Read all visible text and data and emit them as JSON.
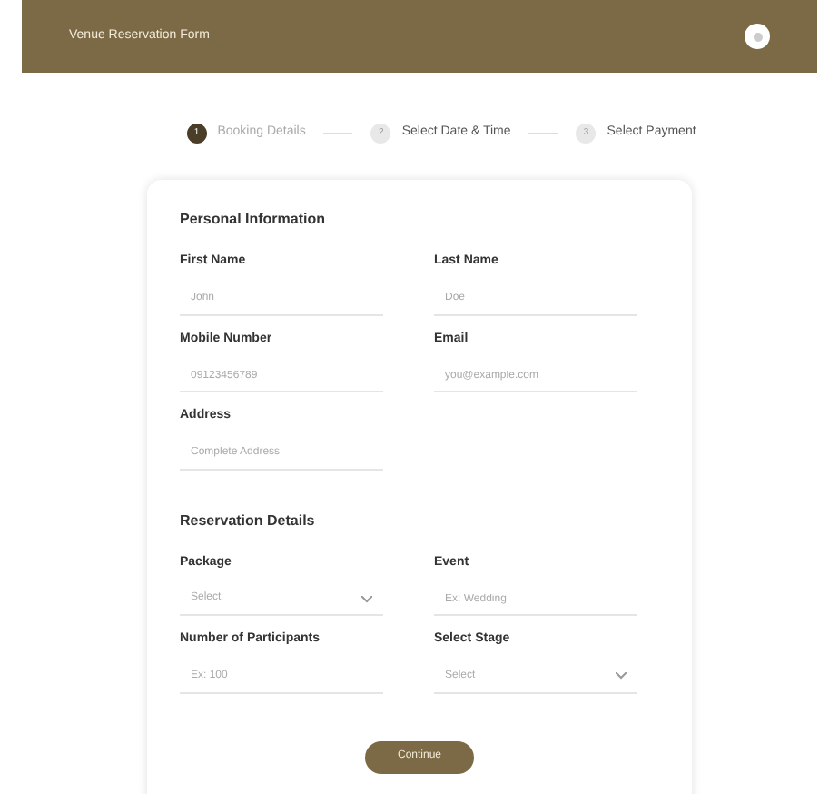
{
  "header": {
    "title": "Venue Reservation Form"
  },
  "steps": [
    {
      "number": "1",
      "label": "Booking Details",
      "selected": true
    },
    {
      "number": "2",
      "label": "Select Date & Time",
      "selected": false
    },
    {
      "number": "3",
      "label": "Select Payment",
      "selected": false
    }
  ],
  "sections": [
    {
      "title": "Personal Information",
      "fields": [
        {
          "label": "First Name",
          "placeholder": "John",
          "kind": "text"
        },
        {
          "label": "Last Name",
          "placeholder": "Doe",
          "kind": "text"
        },
        {
          "label": "Mobile Number",
          "placeholder": "09123456789",
          "kind": "text"
        },
        {
          "label": "Email",
          "placeholder": "you@example.com",
          "kind": "text"
        },
        {
          "label": "Address",
          "placeholder": "Complete Address",
          "kind": "text"
        }
      ]
    },
    {
      "title": "Reservation Details",
      "fields": [
        {
          "label": "Package",
          "placeholder": "Select",
          "kind": "select"
        },
        {
          "label": "Event",
          "placeholder": "Ex: Wedding",
          "kind": "text"
        },
        {
          "label": "Number of Participants",
          "placeholder": "Ex: 100",
          "kind": "text"
        },
        {
          "label": "Select Stage",
          "placeholder": "Select",
          "kind": "select"
        }
      ]
    }
  ],
  "continue_button": "Continue"
}
